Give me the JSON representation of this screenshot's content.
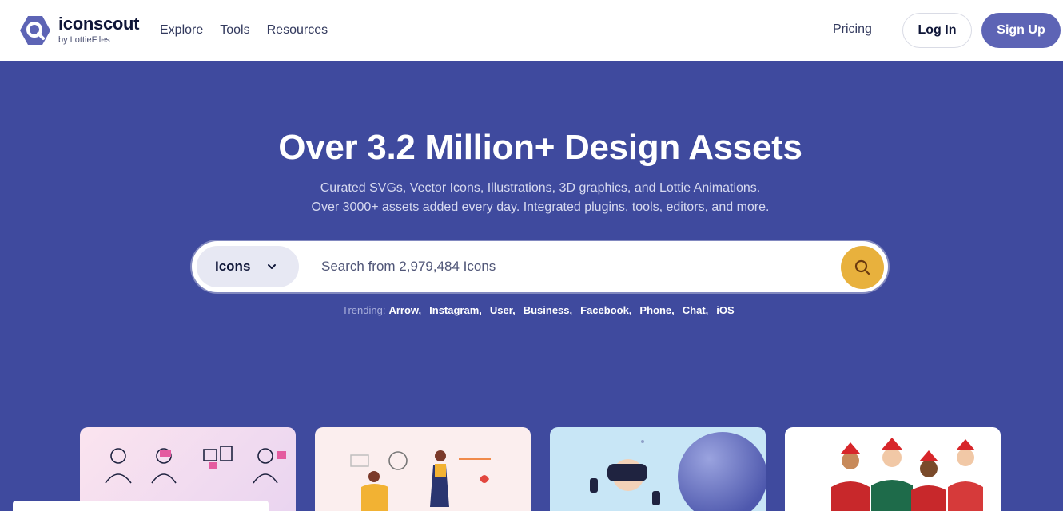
{
  "header": {
    "logo_name": "iconscout",
    "logo_sub": "by LottieFiles",
    "nav": [
      {
        "label": "Explore"
      },
      {
        "label": "Tools"
      },
      {
        "label": "Resources"
      }
    ],
    "pricing": "Pricing",
    "login": "Log In",
    "signup": "Sign Up"
  },
  "hero": {
    "title": "Over 3.2 Million+ Design Assets",
    "subtitle_line1": "Curated SVGs, Vector Icons, Illustrations, 3D graphics, and Lottie Animations.",
    "subtitle_line2": "Over 3000+ assets added every day. Integrated plugins, tools, editors, and more."
  },
  "search": {
    "type_selected": "Icons",
    "placeholder": "Search from 2,979,484 Icons",
    "value": ""
  },
  "trending": {
    "label": "Trending:",
    "items": [
      "Arrow,",
      "Instagram,",
      "User,",
      "Business,",
      "Facebook,",
      "Phone,",
      "Chat,",
      "iOS"
    ]
  },
  "colors": {
    "hero_bg": "#3f4a9e",
    "brand": "#5d64b5",
    "search_button": "#e8b13d"
  },
  "icons": {
    "logo": "iconscout-logo-icon",
    "dropdown": "chevron-down-icon",
    "search": "search-icon"
  }
}
